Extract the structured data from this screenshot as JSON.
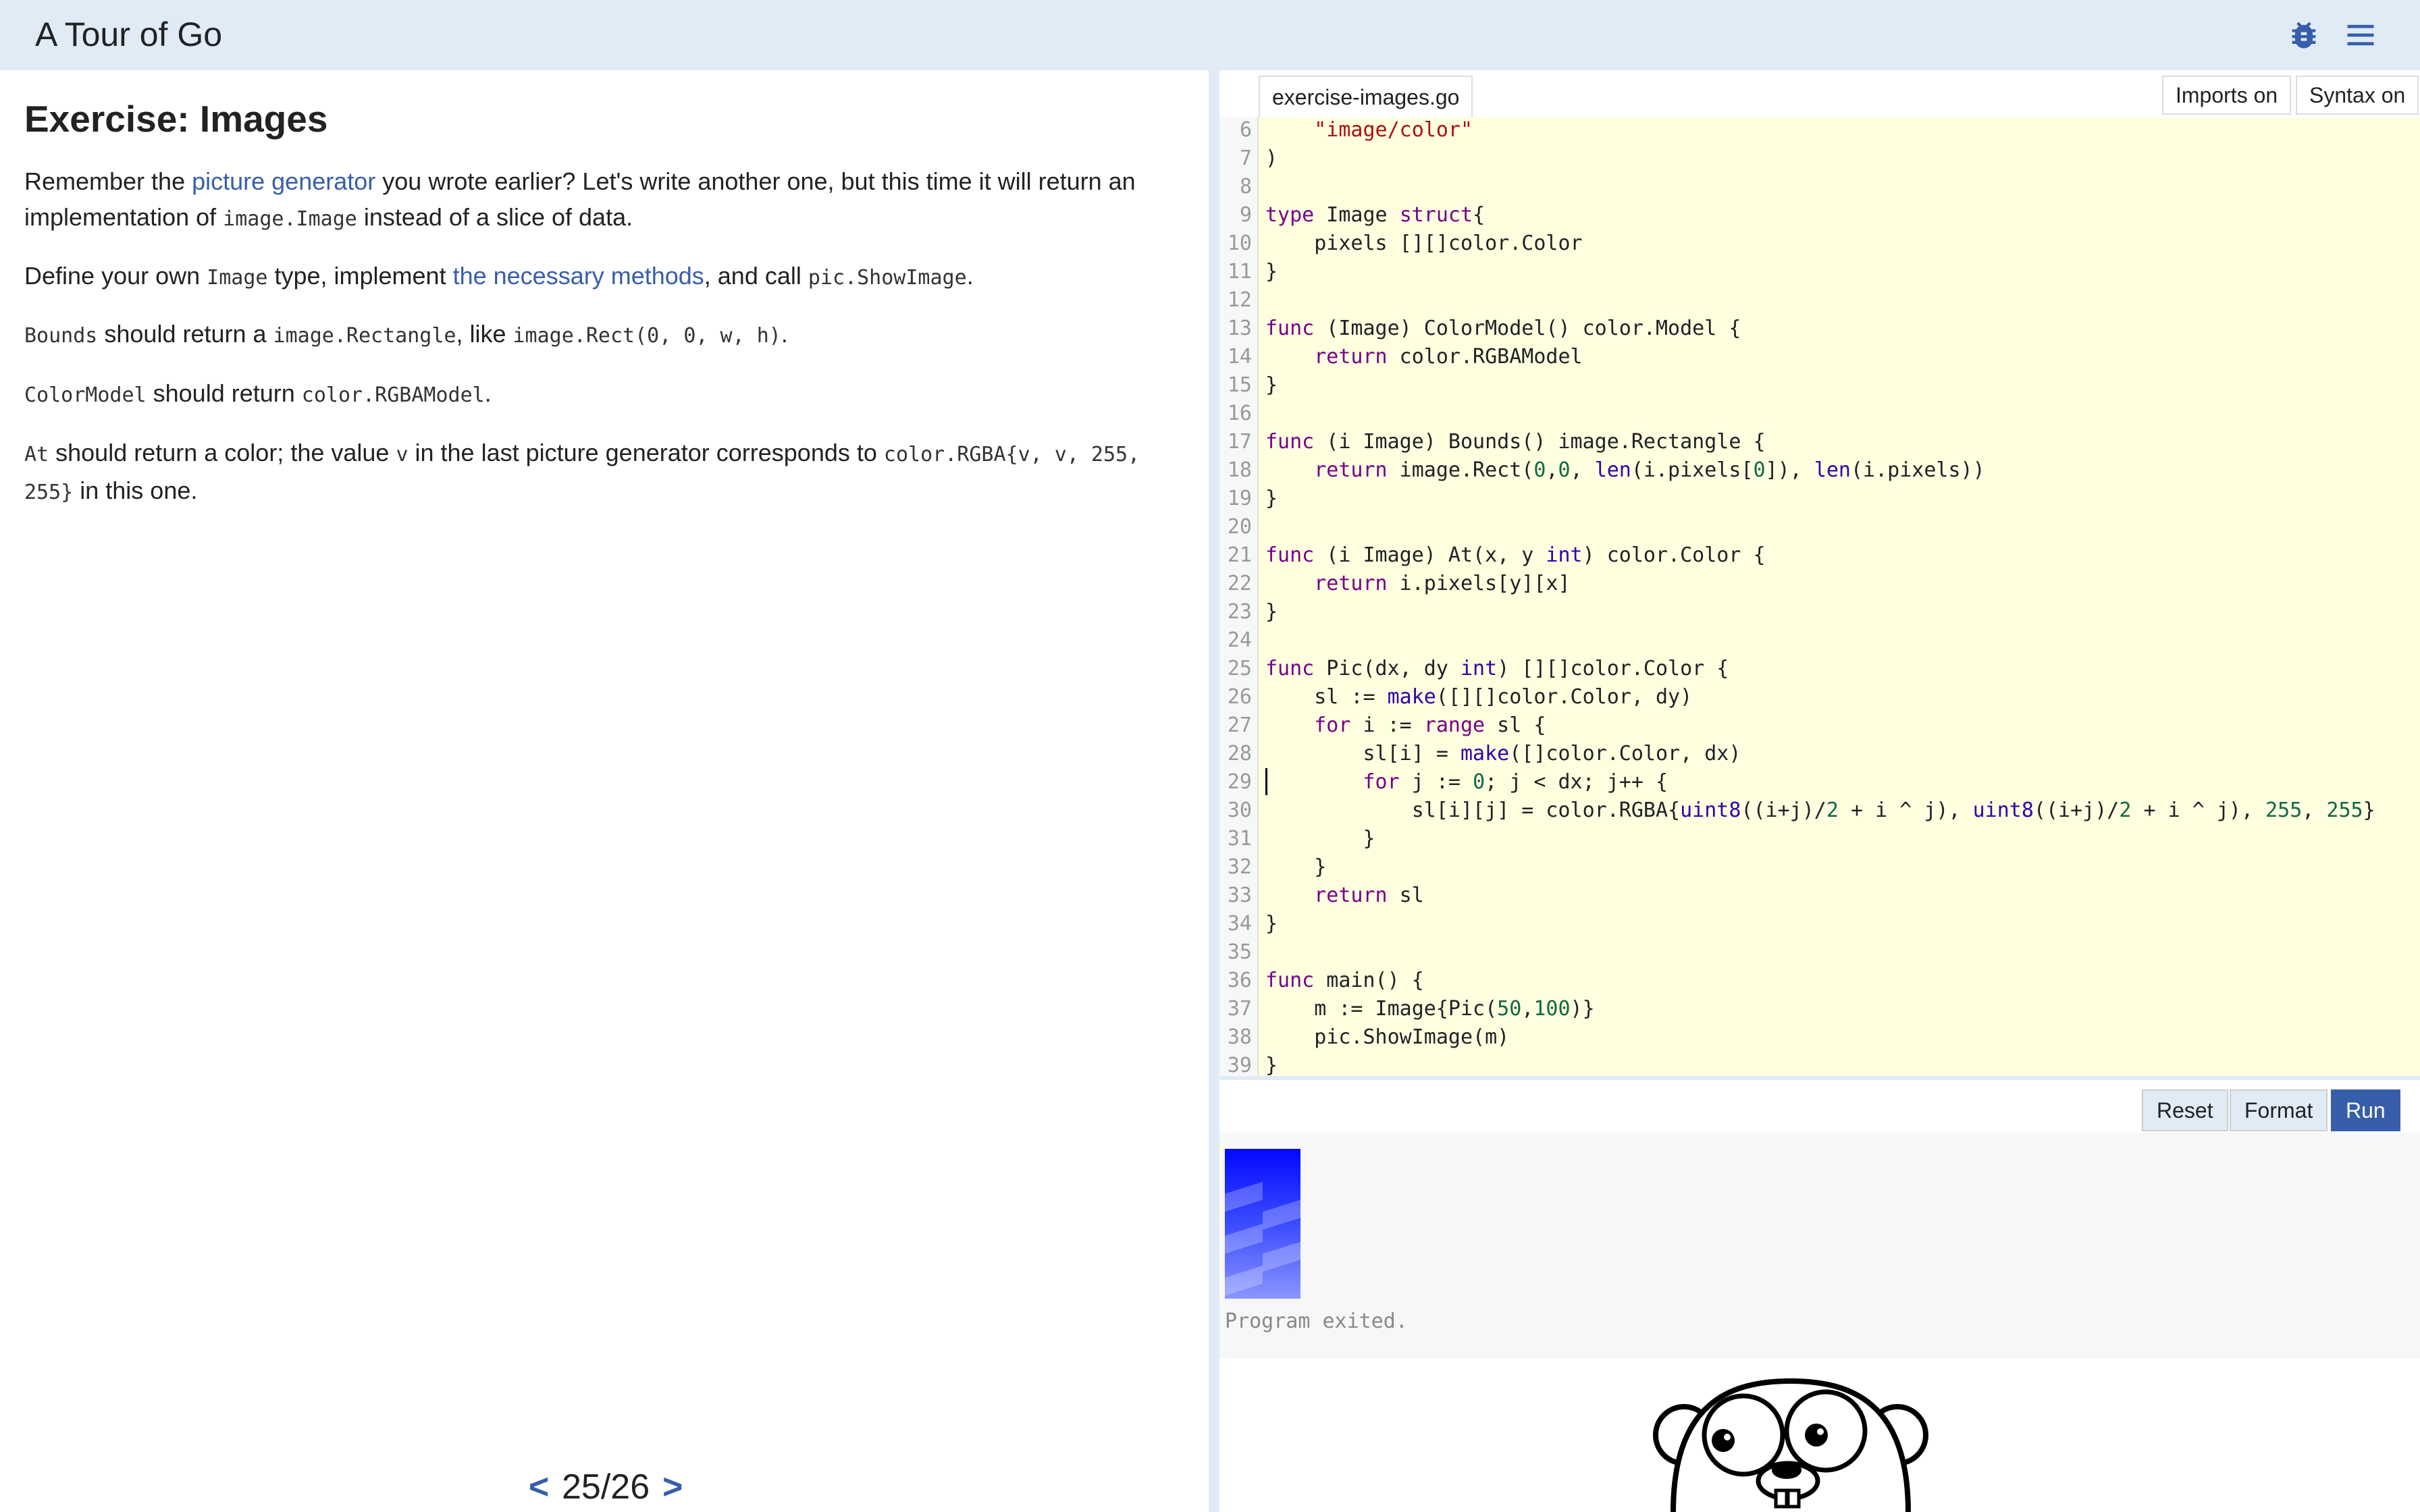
{
  "app": {
    "title": "A Tour of Go"
  },
  "header": {
    "bug_icon": "bug-icon",
    "menu_icon": "hamburger-menu-icon"
  },
  "lesson": {
    "title": "Exercise: Images",
    "p1": {
      "before": "Remember the ",
      "link": "picture generator",
      "after1": " you wrote earlier? Let's write another one, but this time it will return an implementation of ",
      "code": "image.Image",
      "after2": " instead of a slice of data."
    },
    "p2": {
      "before": "Define your own ",
      "code1": "Image",
      "mid": " type, implement ",
      "link": "the necessary methods",
      "mid2": ", and call ",
      "code2": "pic.ShowImage",
      "after": "."
    },
    "p3": {
      "code1": "Bounds",
      "mid": " should return a ",
      "code2": "image.Rectangle",
      "mid2": ", like ",
      "code3": "image.Rect(0, 0, w, h)",
      "after": "."
    },
    "p4": {
      "code1": "ColorModel",
      "mid": " should return ",
      "code2": "color.RGBAModel",
      "after": "."
    },
    "p5": {
      "code1": "At",
      "mid": " should return a color; the value ",
      "code2": "v",
      "mid2": " in the last picture generator corresponds to ",
      "code3": "color.RGBA{v, v, 255, 255}",
      "after": " in this one."
    }
  },
  "pager": {
    "prev": "<",
    "page": "25/26",
    "next": ">"
  },
  "editor": {
    "file_tab": "exercise-images.go",
    "imports_label": "Imports on",
    "syntax_label": "Syntax on",
    "cursor_line": 29,
    "lines": [
      {
        "n": "6",
        "t": "\t\"image/color\""
      },
      {
        "n": "7",
        "t": ")"
      },
      {
        "n": "8",
        "t": ""
      },
      {
        "n": "9",
        "t": "type Image struct{"
      },
      {
        "n": "10",
        "t": "\tpixels [][]color.Color"
      },
      {
        "n": "11",
        "t": "}"
      },
      {
        "n": "12",
        "t": ""
      },
      {
        "n": "13",
        "t": "func (Image) ColorModel() color.Model {"
      },
      {
        "n": "14",
        "t": "\treturn color.RGBAModel"
      },
      {
        "n": "15",
        "t": "}"
      },
      {
        "n": "16",
        "t": ""
      },
      {
        "n": "17",
        "t": "func (i Image) Bounds() image.Rectangle {"
      },
      {
        "n": "18",
        "t": "\treturn image.Rect(0,0, len(i.pixels[0]), len(i.pixels))"
      },
      {
        "n": "19",
        "t": "}"
      },
      {
        "n": "20",
        "t": ""
      },
      {
        "n": "21",
        "t": "func (i Image) At(x, y int) color.Color {"
      },
      {
        "n": "22",
        "t": "\treturn i.pixels[y][x]"
      },
      {
        "n": "23",
        "t": "}"
      },
      {
        "n": "24",
        "t": ""
      },
      {
        "n": "25",
        "t": "func Pic(dx, dy int) [][]color.Color {"
      },
      {
        "n": "26",
        "t": "\tsl := make([][]color.Color, dy)"
      },
      {
        "n": "27",
        "t": "\tfor i := range sl {"
      },
      {
        "n": "28",
        "t": "\t\tsl[i] = make([]color.Color, dx)"
      },
      {
        "n": "29",
        "t": "\t\tfor j := 0; j < dx; j++ {"
      },
      {
        "n": "30",
        "t": "\t\t\tsl[i][j] = color.RGBA{uint8((i+j)/2 + i ^ j), uint8((i+j)/2 + i ^ j), 255, 255}"
      },
      {
        "n": "31",
        "t": "\t\t}"
      },
      {
        "n": "32",
        "t": "\t}"
      },
      {
        "n": "33",
        "t": "\treturn sl"
      },
      {
        "n": "34",
        "t": "}"
      },
      {
        "n": "35",
        "t": ""
      },
      {
        "n": "36",
        "t": "func main() {"
      },
      {
        "n": "37",
        "t": "\tm := Image{Pic(50,100)}"
      },
      {
        "n": "38",
        "t": "\tpic.ShowImage(m)"
      },
      {
        "n": "39",
        "t": "}"
      }
    ]
  },
  "actions": {
    "reset": "Reset",
    "format": "Format",
    "run": "Run"
  },
  "output": {
    "status": "Program exited."
  },
  "colors": {
    "accent": "#375eab",
    "header_bg": "#e0ebf5",
    "editor_bg": "#ffffe0",
    "keyword": "#770088",
    "string": "#aa1111",
    "number": "#116644",
    "builtin": "#3300aa"
  }
}
